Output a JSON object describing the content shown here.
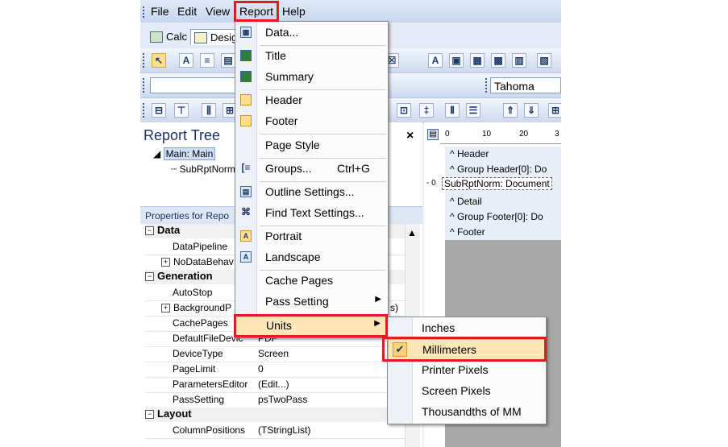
{
  "menubar": {
    "items": [
      "File",
      "Edit",
      "View",
      "Report",
      "Help"
    ]
  },
  "tabs": [
    "Calc",
    "Desig"
  ],
  "toolbar": {
    "font_name": "Tahoma"
  },
  "report_tree": {
    "title": "Report Tree",
    "close": "×",
    "items": [
      "Main: Main",
      "SubRptNorm"
    ]
  },
  "properties": {
    "header": "Properties for Repo",
    "categories": [
      {
        "name": "Data",
        "rows": [
          {
            "name": "DataPipeline",
            "value": "",
            "expandable": false
          },
          {
            "name": "NoDataBehav",
            "value": "",
            "expandable": true
          }
        ]
      },
      {
        "name": "Generation",
        "rows": [
          {
            "name": "AutoStop",
            "value": "",
            "expandable": false
          },
          {
            "name": "BackgroundP",
            "value": "s)",
            "expandable": true
          },
          {
            "name": "CachePages",
            "value": "",
            "expandable": false
          },
          {
            "name": "DefaultFileDevic",
            "value": "PDF",
            "expandable": false
          },
          {
            "name": "DeviceType",
            "value": "Screen",
            "expandable": false
          },
          {
            "name": "PageLimit",
            "value": "0",
            "expandable": false
          },
          {
            "name": "ParametersEditor",
            "value": "(Edit...)",
            "expandable": false
          },
          {
            "name": "PassSetting",
            "value": "psTwoPass",
            "expandable": false
          }
        ]
      },
      {
        "name": "Layout",
        "rows": [
          {
            "name": "ColumnPositions",
            "value": "(TStringList)",
            "expandable": false
          }
        ]
      }
    ]
  },
  "design": {
    "ruler": [
      "0",
      "10",
      "20",
      "3"
    ],
    "bands": [
      "^ Header",
      "^ Group Header[0]: Do",
      "SubRptNorm: Document",
      "^ Detail",
      "^ Group Footer[0]: Do",
      "^ Footer"
    ],
    "band_marker": "- 0"
  },
  "report_menu": {
    "items": [
      {
        "label": "Data...",
        "shortcut": "",
        "icon": "data-icon"
      },
      {
        "label": "Title",
        "shortcut": "",
        "icon": "title-band-icon"
      },
      {
        "label": "Summary",
        "shortcut": "",
        "icon": "summary-band-icon"
      },
      {
        "label": "Header",
        "shortcut": "",
        "icon": "header-icon"
      },
      {
        "label": "Footer",
        "shortcut": "",
        "icon": "footer-icon"
      },
      {
        "label": "Page Style",
        "shortcut": "",
        "icon": ""
      },
      {
        "label": "Groups...",
        "shortcut": "Ctrl+G",
        "icon": "groups-icon"
      },
      {
        "label": "Outline Settings...",
        "shortcut": "",
        "icon": "outline-icon"
      },
      {
        "label": "Find Text Settings...",
        "shortcut": "",
        "icon": "binoculars-icon"
      },
      {
        "label": "Portrait",
        "shortcut": "",
        "icon": "portrait-icon"
      },
      {
        "label": "Landscape",
        "shortcut": "",
        "icon": "landscape-icon"
      },
      {
        "label": "Cache Pages",
        "shortcut": "",
        "icon": ""
      },
      {
        "label": "Pass Setting",
        "shortcut": "",
        "icon": ""
      },
      {
        "label": "Units",
        "shortcut": "",
        "icon": ""
      }
    ]
  },
  "units_menu": {
    "items": [
      "Inches",
      "Millimeters",
      "Printer Pixels",
      "Screen Pixels",
      "Thousandths of MM"
    ],
    "checked": "Millimeters",
    "check_mark": "✔"
  },
  "colors": {
    "highlight_box": "#e01b24",
    "menu_hover": "#fce6b8"
  }
}
